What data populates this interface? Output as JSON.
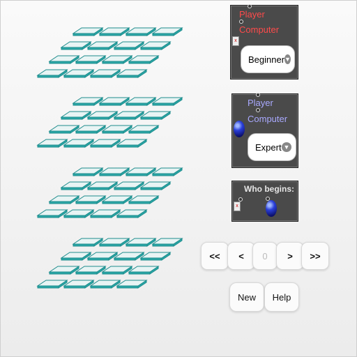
{
  "colors": {
    "tile_top": "#e8f4f4",
    "tile_edge": "#1e8c8c",
    "panel_bg": "#4a4a4a",
    "player_red": "#ff4b4b",
    "player_blue": "#a9a9ff",
    "ball_blue": "#2a3fd8"
  },
  "boards": [
    {
      "name": "board-1",
      "rows": 4,
      "cols": 4
    },
    {
      "name": "board-2",
      "rows": 4,
      "cols": 4
    },
    {
      "name": "board-3",
      "rows": 4,
      "cols": 4
    },
    {
      "name": "board-4",
      "rows": 4,
      "cols": 4
    }
  ],
  "panel1": {
    "player_label": "Player",
    "computer_label": "Computer",
    "level": "Beginner"
  },
  "panel2": {
    "player_label": "Player",
    "computer_label": "Computer",
    "level": "Expert"
  },
  "panel3": {
    "who_begins": "Who begins:"
  },
  "nav": {
    "first": "<<",
    "prev": "<",
    "page": "0",
    "next": ">",
    "last": ">>"
  },
  "actions": {
    "new": "New",
    "help": "Help"
  }
}
